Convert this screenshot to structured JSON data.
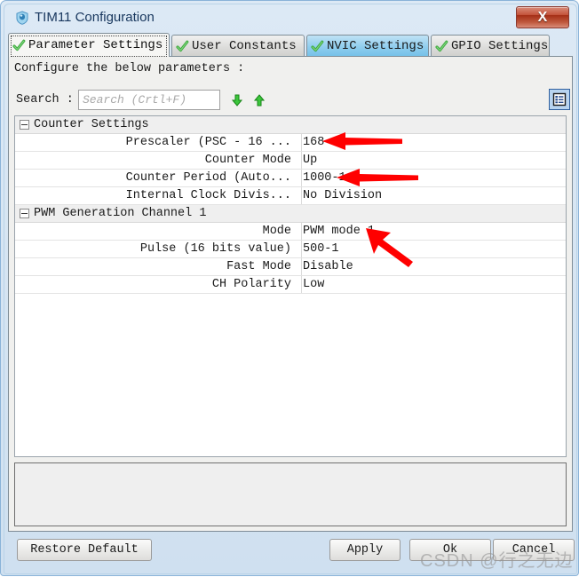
{
  "window": {
    "title": "TIM11 Configuration",
    "icon": "shield-icon",
    "close_label": "X"
  },
  "tabs": [
    {
      "label": "Parameter Settings",
      "icon": "green-check-icon",
      "state": "selected"
    },
    {
      "label": "User Constants",
      "icon": "green-check-icon",
      "state": "normal"
    },
    {
      "label": "NVIC Settings",
      "icon": "green-check-icon",
      "state": "hovered"
    },
    {
      "label": "GPIO Settings",
      "icon": "green-check-icon",
      "state": "normal"
    }
  ],
  "content": {
    "instruction": "Configure the below parameters :",
    "search_label": "Search :",
    "search_value": "",
    "search_placeholder": "Search (Crtl+F)",
    "search_next_icon": "arrow-down-green-icon",
    "search_prev_icon": "arrow-up-green-icon",
    "view_toggle_icon": "list-view-icon"
  },
  "groups": [
    {
      "title": "Counter Settings",
      "rows": [
        {
          "name": "Prescaler (PSC - 16 ...",
          "value": "168-1"
        },
        {
          "name": "Counter Mode",
          "value": "Up"
        },
        {
          "name": "Counter Period (Auto...",
          "value": "1000-1"
        },
        {
          "name": "Internal Clock Divis...",
          "value": "No Division"
        }
      ]
    },
    {
      "title": "PWM Generation Channel 1",
      "rows": [
        {
          "name": "Mode",
          "value": "PWM mode 1"
        },
        {
          "name": "Pulse (16 bits value)",
          "value": "500-1"
        },
        {
          "name": "Fast Mode",
          "value": "Disable"
        },
        {
          "name": "CH Polarity",
          "value": "Low"
        }
      ]
    }
  ],
  "footer": {
    "restore_label": "Restore Default",
    "apply_label": "Apply",
    "ok_label": "Ok",
    "cancel_label": "Cancel"
  },
  "annotations": {
    "color": "#ff0000",
    "arrows": [
      {
        "target": "prescaler-value",
        "direction": "left"
      },
      {
        "target": "counter-period-value",
        "direction": "left"
      },
      {
        "target": "mode-value",
        "direction": "up-left"
      }
    ]
  },
  "watermark": {
    "text": "CSDN @行之无边"
  }
}
